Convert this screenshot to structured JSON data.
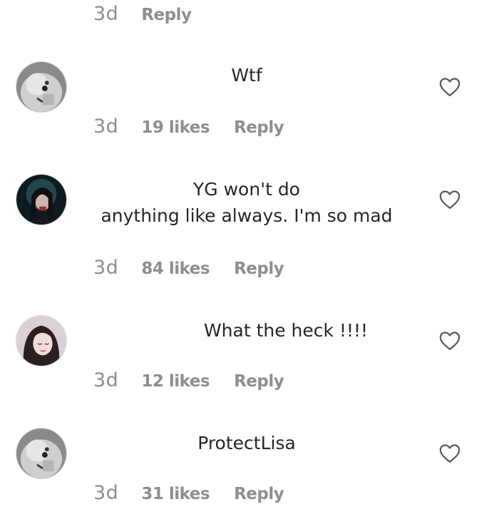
{
  "top_meta": {
    "time": "3d",
    "reply_label": "Reply"
  },
  "comments": [
    {
      "text_lines": [
        "Wtf"
      ],
      "time": "3d",
      "likes": "19 likes",
      "reply_label": "Reply",
      "avatar": "cartoon-avatar"
    },
    {
      "text_lines": [
        "YG won't do",
        "anything like always. I'm so mad"
      ],
      "time": "3d",
      "likes": "84 likes",
      "reply_label": "Reply",
      "avatar": "dark-portrait-avatar"
    },
    {
      "text_lines": [
        "What the heck !!!!"
      ],
      "time": "3d",
      "likes": "12 likes",
      "reply_label": "Reply",
      "avatar": "girl-portrait-avatar"
    },
    {
      "text_lines": [
        "ProtectLisa"
      ],
      "time": "3d",
      "likes": "31 likes",
      "reply_label": "Reply",
      "avatar": "cartoon-avatar"
    }
  ],
  "icons": {
    "like": "heart-outline-icon"
  },
  "colors": {
    "text": "#262626",
    "secondary": "#8e8e8e",
    "background": "#ffffff"
  }
}
